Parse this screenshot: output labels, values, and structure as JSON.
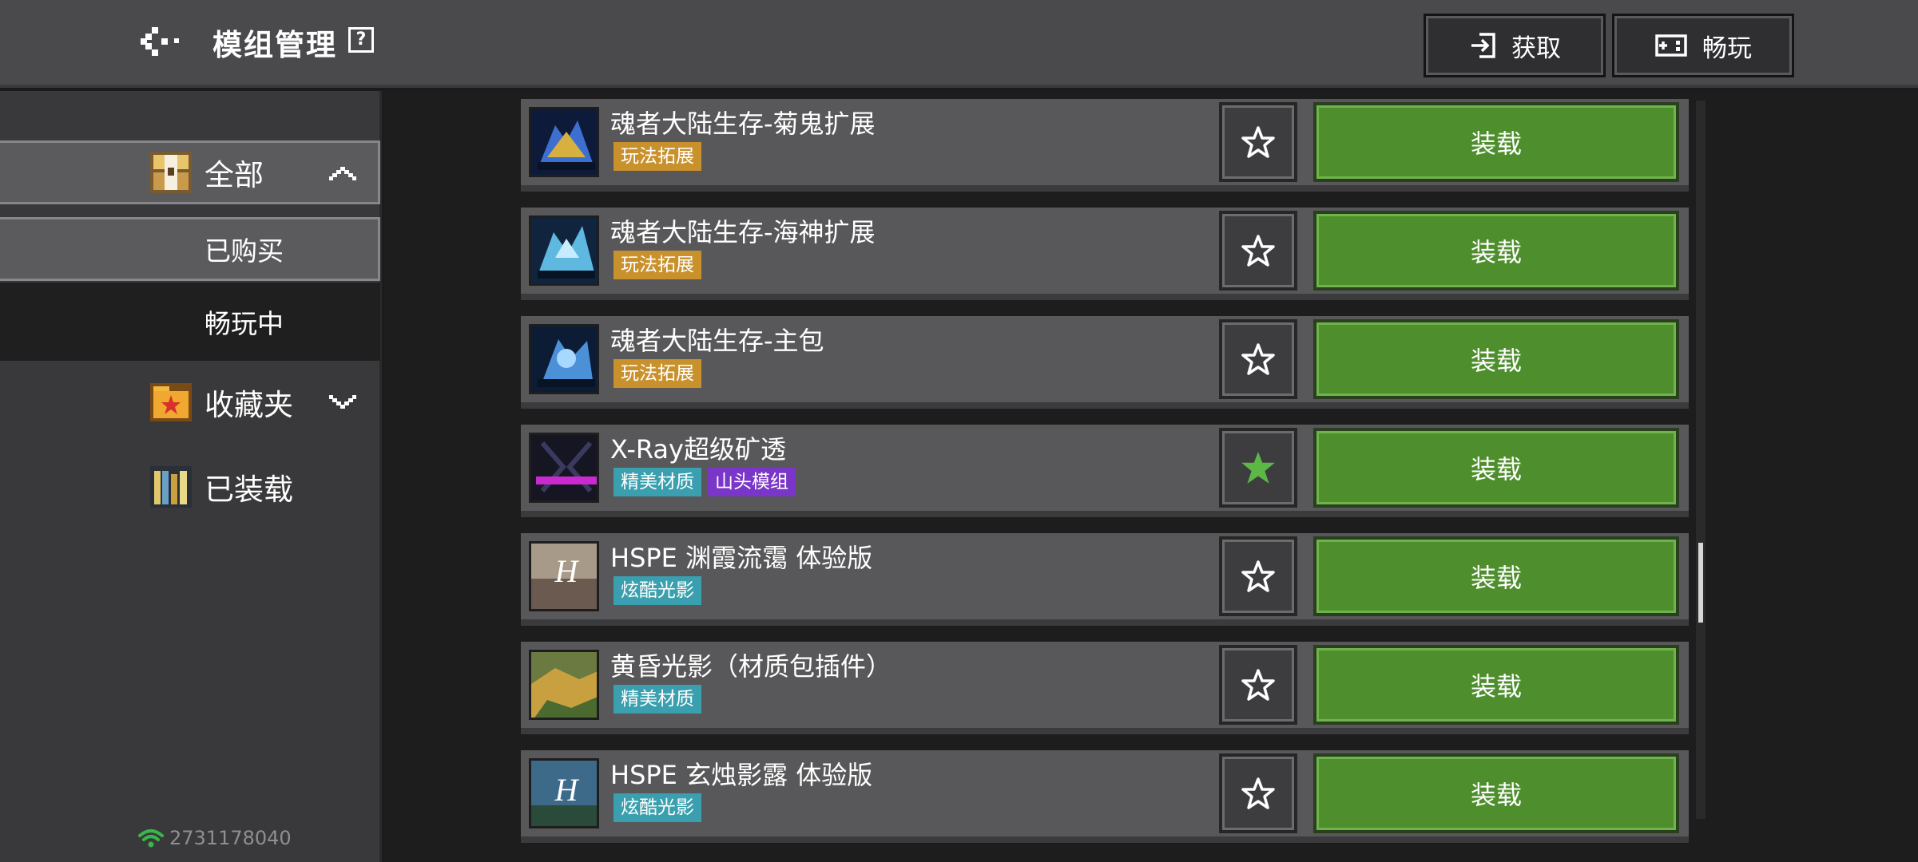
{
  "header": {
    "title": "模组管理",
    "help_icon": "?",
    "get_label": "获取",
    "play_label": "畅玩"
  },
  "sidebar": {
    "all_label": "全部",
    "bought_label": "已购买",
    "playing_label": "畅玩中",
    "favorites_label": "收藏夹",
    "loaded_label": "已装载"
  },
  "footer": {
    "user_id": "2731178040"
  },
  "colors": {
    "tag_gameplay": "#c9912c",
    "tag_material": "#3a9fae",
    "tag_mountain": "#7a36c8",
    "tag_shader": "#3a9fae",
    "load_green": "#4e8e2d",
    "fav_star_active": "#5cb845"
  },
  "mods": [
    {
      "name": "魂者大陆生存-菊鬼扩展",
      "tags": [
        {
          "label": "玩法拓展",
          "color": "#c9912c"
        }
      ],
      "favorited": false,
      "action": "装载",
      "thumb": "blue-dragon"
    },
    {
      "name": "魂者大陆生存-海神扩展",
      "tags": [
        {
          "label": "玩法拓展",
          "color": "#c9912c"
        }
      ],
      "favorited": false,
      "action": "装载",
      "thumb": "sea-god"
    },
    {
      "name": "魂者大陆生存-主包",
      "tags": [
        {
          "label": "玩法拓展",
          "color": "#c9912c"
        }
      ],
      "favorited": false,
      "action": "装载",
      "thumb": "main-pack"
    },
    {
      "name": "X-Ray超级矿透",
      "tags": [
        {
          "label": "精美材质",
          "color": "#3a9fae"
        },
        {
          "label": "山头模组",
          "color": "#7a36c8"
        }
      ],
      "favorited": true,
      "action": "装载",
      "thumb": "x-ray"
    },
    {
      "name": "HSPE 渊霞流霭 体验版",
      "tags": [
        {
          "label": "炫酷光影",
          "color": "#3a9fae"
        }
      ],
      "favorited": false,
      "action": "装载",
      "thumb": "hspe-sunset"
    },
    {
      "name": "黄昏光影（材质包插件）",
      "tags": [
        {
          "label": "精美材质",
          "color": "#3a9fae"
        }
      ],
      "favorited": false,
      "action": "装载",
      "thumb": "dusk-shader"
    },
    {
      "name": "HSPE 玄烛影露 体验版",
      "tags": [
        {
          "label": "炫酷光影",
          "color": "#3a9fae"
        }
      ],
      "favorited": false,
      "action": "装载",
      "thumb": "hspe-legend"
    }
  ]
}
